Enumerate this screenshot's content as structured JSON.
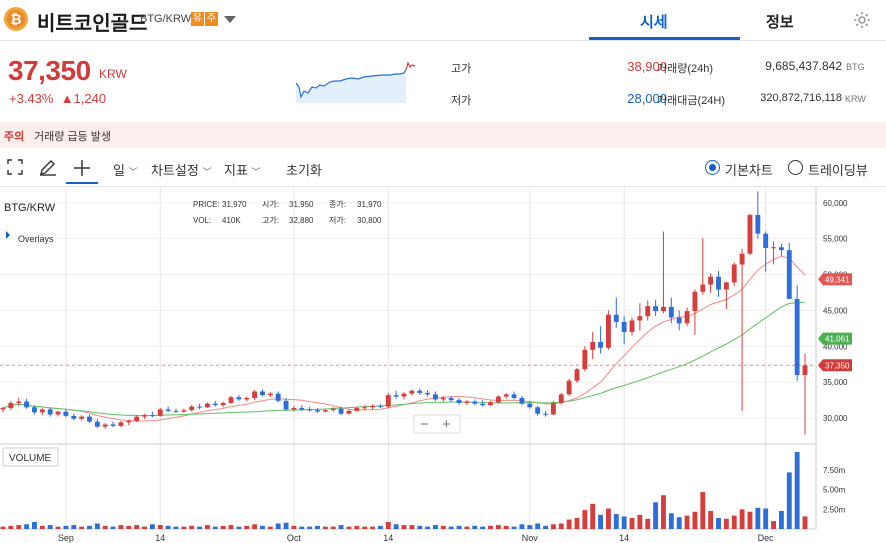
{
  "header": {
    "coin_name": "비트코인골드",
    "market": "BTG/KRW",
    "badge_1": "유",
    "badge_2": "주",
    "tab_quote": "시세",
    "tab_info": "정보"
  },
  "price": {
    "current": "37,350",
    "unit": "KRW",
    "change_rate": "+3.43%",
    "change_amount": "▲1,240"
  },
  "stats": {
    "high_label": "고가",
    "high_value": "38,900",
    "low_label": "저가",
    "low_value": "28,000",
    "volume_label": "거래량(24h)",
    "volume_value": "9,685,437.842",
    "volume_unit": "BTG",
    "amount_label": "거래대금(24H)",
    "amount_value": "320,872,716,118",
    "amount_unit": "KRW"
  },
  "notice": {
    "tag": "주의",
    "text": "거래량 급등 발생"
  },
  "toolbar": {
    "interval": "일",
    "chart_settings": "차트설정",
    "indicators": "지표",
    "reset": "초기화",
    "basic_chart": "기본차트",
    "trading_view": "트레이딩뷰"
  },
  "chart_data": {
    "type": "candlestick",
    "symbol": "BTG/KRW",
    "overlays_label": "Overlays",
    "info": {
      "price_label": "PRICE:",
      "price": "31,970",
      "open_label": "시가:",
      "open": "31,950",
      "close_label": "종가:",
      "close": "31,970",
      "vol_label": "VOL:",
      "vol": "410K",
      "high_label": "고가:",
      "high": "32,880",
      "low_label": "저가:",
      "low": "30,800"
    },
    "price_axis": [
      "60,000",
      "55,000",
      "50,000",
      "45,000",
      "40,000",
      "35,000",
      "30,000"
    ],
    "price_axis_values": [
      60000,
      55000,
      50000,
      45000,
      40000,
      35000,
      30000
    ],
    "price_range": [
      27500,
      61500
    ],
    "markers": [
      {
        "label": "49,341",
        "value": 49341,
        "color": "#e05656"
      },
      {
        "label": "41,061",
        "value": 41061,
        "color": "#4caf50"
      },
      {
        "label": "37,350",
        "value": 37350,
        "color": "#d23b3b"
      }
    ],
    "volume_label": "VOLUME",
    "volume_axis": [
      "7.50m",
      "5.00m",
      "2.50m"
    ],
    "volume_axis_values": [
      7500000,
      5000000,
      2500000
    ],
    "volume_max": 9800000,
    "x_labels": [
      {
        "label": "Sep",
        "i": 8
      },
      {
        "label": "14",
        "i": 20
      },
      {
        "label": "Oct",
        "i": 37
      },
      {
        "label": "14",
        "i": 49
      },
      {
        "label": "Nov",
        "i": 67
      },
      {
        "label": "14",
        "i": 79
      },
      {
        "label": "Dec",
        "i": 97
      }
    ],
    "candles": [
      [
        31200,
        31600,
        30800,
        31400,
        300
      ],
      [
        31400,
        32400,
        31100,
        32100,
        400
      ],
      [
        32100,
        32800,
        31700,
        32300,
        500
      ],
      [
        32300,
        32700,
        31300,
        31500,
        600
      ],
      [
        31500,
        31800,
        30500,
        30800,
        900
      ],
      [
        30800,
        31400,
        30400,
        31200,
        400
      ],
      [
        31200,
        31500,
        30200,
        30500,
        500
      ],
      [
        30500,
        31000,
        30200,
        30900,
        300
      ],
      [
        30900,
        31200,
        30100,
        30300,
        400
      ],
      [
        30300,
        30600,
        29700,
        29900,
        500
      ],
      [
        29900,
        30400,
        29600,
        30200,
        300
      ],
      [
        30200,
        30500,
        29300,
        29500,
        400
      ],
      [
        29500,
        29900,
        28600,
        28800,
        700
      ],
      [
        28800,
        29300,
        28500,
        29100,
        400
      ],
      [
        29100,
        29500,
        28700,
        28900,
        300
      ],
      [
        28900,
        29600,
        28700,
        29400,
        500
      ],
      [
        29400,
        29800,
        29000,
        29600,
        400
      ],
      [
        29600,
        30400,
        29400,
        30200,
        500
      ],
      [
        30200,
        30600,
        29900,
        30400,
        300
      ],
      [
        30400,
        30900,
        30100,
        30300,
        600
      ],
      [
        30300,
        31400,
        30200,
        31200,
        500
      ],
      [
        31200,
        31600,
        30800,
        31000,
        400
      ],
      [
        31000,
        31300,
        30700,
        30900,
        300
      ],
      [
        30900,
        31300,
        30700,
        31100,
        300
      ],
      [
        31100,
        31800,
        30900,
        31600,
        400
      ],
      [
        31600,
        32000,
        31200,
        31500,
        300
      ],
      [
        31500,
        32200,
        31400,
        32000,
        500
      ],
      [
        32000,
        32400,
        31600,
        31800,
        300
      ],
      [
        31800,
        32300,
        31500,
        32100,
        400
      ],
      [
        32100,
        33100,
        32000,
        32900,
        500
      ],
      [
        32900,
        33200,
        32400,
        32600,
        300
      ],
      [
        32600,
        33000,
        32300,
        32800,
        400
      ],
      [
        32800,
        33900,
        32500,
        33700,
        600
      ],
      [
        33700,
        34000,
        33000,
        33200,
        400
      ],
      [
        33200,
        33600,
        32900,
        33400,
        300
      ],
      [
        33400,
        33700,
        32200,
        32400,
        700
      ],
      [
        32400,
        32800,
        31000,
        31200,
        800
      ],
      [
        31200,
        31700,
        30900,
        31400,
        400
      ],
      [
        31400,
        31800,
        31000,
        31200,
        300
      ],
      [
        31200,
        31600,
        30900,
        31100,
        300
      ],
      [
        31100,
        31400,
        30700,
        30900,
        400
      ],
      [
        30900,
        31300,
        30800,
        31100,
        300
      ],
      [
        31100,
        31500,
        30900,
        31300,
        300
      ],
      [
        31300,
        31600,
        30400,
        30600,
        500
      ],
      [
        30600,
        31200,
        30500,
        31000,
        300
      ],
      [
        31000,
        31600,
        30900,
        31400,
        400
      ],
      [
        31400,
        31800,
        31100,
        31500,
        300
      ],
      [
        31500,
        31900,
        31200,
        31700,
        300
      ],
      [
        31700,
        32000,
        31400,
        31600,
        400
      ],
      [
        31600,
        33500,
        31400,
        33200,
        900
      ],
      [
        33200,
        33800,
        32700,
        33000,
        600
      ],
      [
        33000,
        33600,
        32600,
        33400,
        500
      ],
      [
        33400,
        34000,
        33100,
        33800,
        500
      ],
      [
        33800,
        34100,
        33200,
        33500,
        400
      ],
      [
        33500,
        33900,
        33000,
        33300,
        300
      ],
      [
        33300,
        33700,
        32400,
        32600,
        500
      ],
      [
        32600,
        33100,
        32300,
        32800,
        400
      ],
      [
        32800,
        33100,
        32300,
        32500,
        300
      ],
      [
        32500,
        32800,
        31900,
        32100,
        400
      ],
      [
        32100,
        32500,
        31800,
        32300,
        300
      ],
      [
        32300,
        32600,
        31800,
        32000,
        400
      ],
      [
        32000,
        32500,
        31600,
        31800,
        300
      ],
      [
        31800,
        32400,
        31700,
        32200,
        400
      ],
      [
        32200,
        33200,
        32000,
        33000,
        500
      ],
      [
        33000,
        33500,
        32700,
        33300,
        400
      ],
      [
        33300,
        33700,
        32600,
        32800,
        300
      ],
      [
        32800,
        33100,
        31800,
        32000,
        600
      ],
      [
        32000,
        32400,
        31300,
        31500,
        500
      ],
      [
        31500,
        31700,
        30300,
        30600,
        700
      ],
      [
        30600,
        31000,
        30200,
        30500,
        400
      ],
      [
        30500,
        32400,
        30400,
        32100,
        600
      ],
      [
        32100,
        33500,
        31900,
        33300,
        700
      ],
      [
        33300,
        35500,
        33100,
        35200,
        1200
      ],
      [
        35200,
        37000,
        34900,
        36800,
        1400
      ],
      [
        36800,
        40000,
        36500,
        39500,
        2400
      ],
      [
        39500,
        42000,
        38200,
        40600,
        3200
      ],
      [
        40600,
        42800,
        39000,
        39800,
        1800
      ],
      [
        39800,
        45000,
        39500,
        44400,
        2600
      ],
      [
        44400,
        46800,
        42600,
        43400,
        1900
      ],
      [
        43400,
        44200,
        40300,
        42000,
        1600
      ],
      [
        42000,
        44000,
        41500,
        43600,
        1400
      ],
      [
        43600,
        46000,
        42200,
        44200,
        1800
      ],
      [
        44200,
        46400,
        43600,
        45600,
        1300
      ],
      [
        45600,
        46500,
        44200,
        44900,
        3400
      ],
      [
        44900,
        56000,
        44600,
        45500,
        4300
      ],
      [
        45500,
        46800,
        43200,
        44000,
        2000
      ],
      [
        44000,
        45000,
        42200,
        43200,
        1500
      ],
      [
        43200,
        45400,
        42800,
        44900,
        1700
      ],
      [
        44900,
        47900,
        41600,
        47600,
        2200
      ],
      [
        47600,
        55100,
        47200,
        48600,
        4700
      ],
      [
        48600,
        50200,
        47400,
        49700,
        2300
      ],
      [
        49700,
        50500,
        46900,
        47900,
        1400
      ],
      [
        47900,
        49000,
        45200,
        48900,
        1300
      ],
      [
        48900,
        51700,
        48400,
        51400,
        1700
      ],
      [
        51400,
        53600,
        31000,
        52900,
        2500
      ],
      [
        52900,
        58500,
        52700,
        58300,
        2200
      ],
      [
        58300,
        61600,
        55000,
        55700,
        2700
      ],
      [
        55700,
        56000,
        50400,
        53700,
        2600
      ],
      [
        53700,
        54600,
        51400,
        53800,
        1000
      ],
      [
        53800,
        54300,
        52600,
        53400,
        2300
      ],
      [
        53400,
        54400,
        46800,
        46600,
        7200
      ],
      [
        46600,
        48500,
        35200,
        36000,
        9800
      ],
      [
        36000,
        39000,
        27700,
        37350,
        1600
      ]
    ]
  }
}
